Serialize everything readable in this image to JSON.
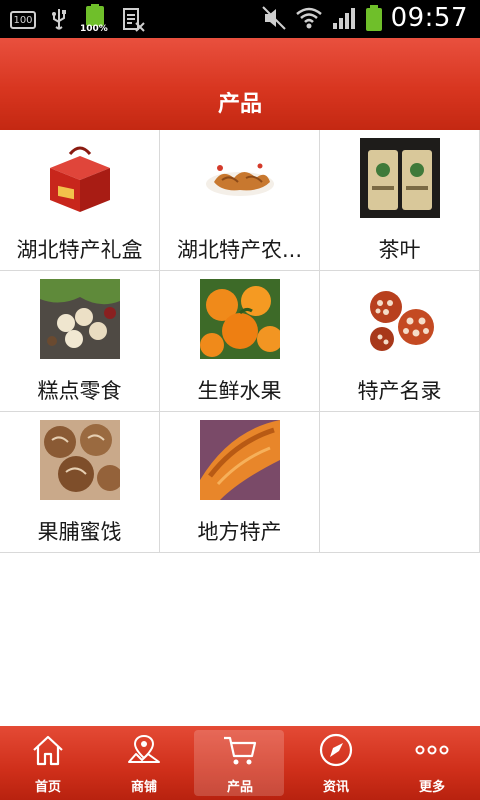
{
  "status_bar": {
    "time": "09:57",
    "left_box": "100",
    "battery_small": "100%"
  },
  "header": {
    "title": "产品"
  },
  "products": [
    {
      "label": "湖北特产礼盒",
      "icon": "gift-box-image"
    },
    {
      "label": "湖北特产农...",
      "icon": "braised-meat-image"
    },
    {
      "label": "茶叶",
      "icon": "tea-bags-image"
    },
    {
      "label": "糕点零食",
      "icon": "pastry-snacks-image"
    },
    {
      "label": "生鲜水果",
      "icon": "oranges-image"
    },
    {
      "label": "特产名录",
      "icon": "lotus-root-image"
    },
    {
      "label": "果脯蜜饯",
      "icon": "dried-fruit-image"
    },
    {
      "label": "地方特产",
      "icon": "local-specialty-image"
    }
  ],
  "nav": [
    {
      "label": "首页",
      "icon": "home-icon"
    },
    {
      "label": "商铺",
      "icon": "map-shop-icon"
    },
    {
      "label": "产品",
      "icon": "cart-icon",
      "active": true
    },
    {
      "label": "资讯",
      "icon": "compass-icon"
    },
    {
      "label": "更多",
      "icon": "more-icon"
    }
  ],
  "colors": {
    "header": "#d83620",
    "nav": "#cf2f1a",
    "grid_border": "#d9d9d9"
  }
}
